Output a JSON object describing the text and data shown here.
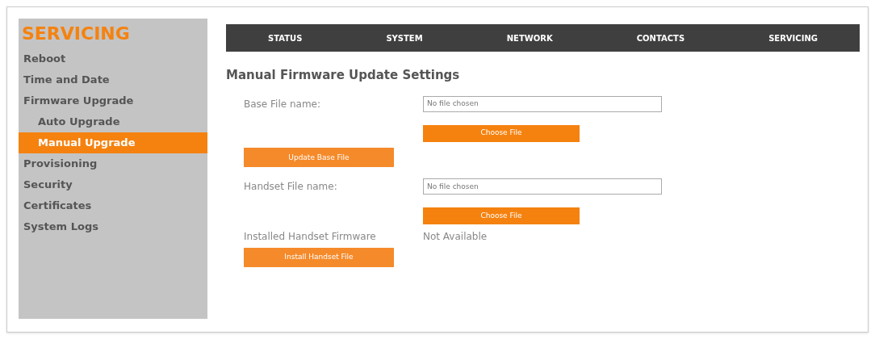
{
  "sidebar": {
    "title": "SERVICING",
    "items": [
      {
        "label": "Reboot",
        "selected": false
      },
      {
        "label": "Time and Date",
        "selected": false
      },
      {
        "label": "Firmware Upgrade",
        "selected": false,
        "children": [
          {
            "label": "Auto Upgrade",
            "selected": false
          },
          {
            "label": "Manual Upgrade",
            "selected": true
          }
        ]
      },
      {
        "label": "Provisioning",
        "selected": false
      },
      {
        "label": "Security",
        "selected": false
      },
      {
        "label": "Certificates",
        "selected": false
      },
      {
        "label": "System Logs",
        "selected": false
      }
    ]
  },
  "nav": [
    "STATUS",
    "SYSTEM",
    "NETWORK",
    "CONTACTS",
    "SERVICING"
  ],
  "heading": "Manual Firmware Update Settings",
  "sections": [
    {
      "label": "Base File name:",
      "field_value": "No file chosen",
      "choose_button": "Choose File",
      "action_button": "Update Base File"
    },
    {
      "label": "Handset File name:",
      "field_value": "No file chosen",
      "choose_button": "Choose File",
      "info_label": "Installed Handset Firmware",
      "info_value": "Not Available",
      "action_button": "Install Handset File"
    }
  ]
}
